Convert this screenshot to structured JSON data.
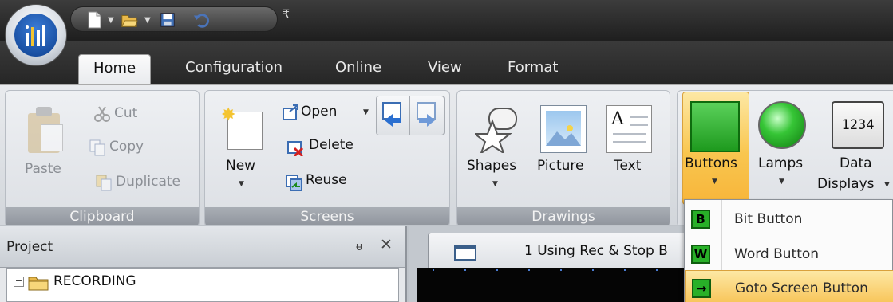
{
  "quick_access": {
    "items": [
      "new-doc-icon",
      "open-folder-icon",
      "save-icon",
      "undo-icon"
    ],
    "customize_glyph": "₹"
  },
  "tabs": [
    {
      "label": "Home",
      "active": true
    },
    {
      "label": "Configuration",
      "active": false
    },
    {
      "label": "Online",
      "active": false
    },
    {
      "label": "View",
      "active": false
    },
    {
      "label": "Format",
      "active": false
    }
  ],
  "ribbon": {
    "clipboard": {
      "group_label": "Clipboard",
      "paste": "Paste",
      "cut": "Cut",
      "copy": "Copy",
      "duplicate": "Duplicate"
    },
    "screens": {
      "group_label": "Screens",
      "new": "New",
      "open": "Open",
      "delete": "Delete",
      "reuse": "Reuse"
    },
    "drawings": {
      "group_label": "Drawings",
      "shapes": "Shapes",
      "picture": "Picture",
      "text": "Text",
      "text_icon_letter": "A"
    },
    "objects": {
      "buttons": "Buttons",
      "lamps": "Lamps",
      "data_displays_1": "Data",
      "data_displays_2": "Displays",
      "data_icon_text": "1234"
    }
  },
  "project_panel": {
    "title": "Project",
    "pin_glyph": "ᵾ",
    "close_glyph": "✕",
    "tree_root": "RECORDING",
    "toggle": "−"
  },
  "document_tab": {
    "label": "1 Using Rec & Stop B"
  },
  "buttons_menu": {
    "items": [
      {
        "icon_letter": "B",
        "label": "Bit Button",
        "highlighted": false
      },
      {
        "icon_letter": "W",
        "label": "Word Button",
        "highlighted": false
      },
      {
        "icon_letter": "→",
        "label": "Goto Screen Button",
        "highlighted": true
      }
    ]
  },
  "colors": {
    "accent_highlight": "#f9c64f",
    "title_bar": "#2a2a2a",
    "ribbon_group_label": "#9aa0a8",
    "button_green": "#28b028"
  }
}
